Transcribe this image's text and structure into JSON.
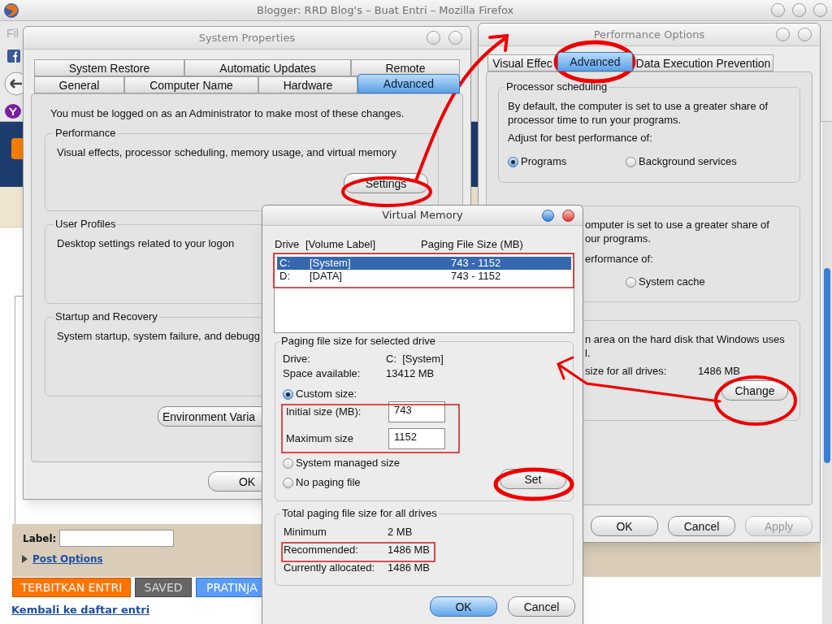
{
  "browser": {
    "title": "Blogger: RRD Blog's – Buat Entri – Mozilla Firefox",
    "menu": [
      "Fil"
    ],
    "page": {
      "label_caption": "Label:",
      "post_options": "Post Options",
      "actions": [
        {
          "label": "TERBITKAN ENTRI",
          "kind": "publish"
        },
        {
          "label": "SAVED",
          "kind": "saved"
        },
        {
          "label": "PRATINJA",
          "kind": "preview"
        }
      ],
      "back_link": "Kembali ke daftar entri"
    }
  },
  "system_properties": {
    "title": "System Properties",
    "tab_rows": [
      [
        {
          "label": "System Restore",
          "selected": false
        },
        {
          "label": "Automatic Updates",
          "selected": false
        },
        {
          "label": "Remote",
          "selected": false
        }
      ],
      [
        {
          "label": "General",
          "selected": false
        },
        {
          "label": "Computer Name",
          "selected": false
        },
        {
          "label": "Hardware",
          "selected": false
        },
        {
          "label": "Advanced",
          "selected": true
        }
      ]
    ],
    "notice": "You must be logged on as an Administrator to make most of these changes.",
    "groups": [
      {
        "title": "Performance",
        "text": "Visual effects, processor scheduling, memory usage, and virtual memory",
        "button": "Settings"
      },
      {
        "title": "User Profiles",
        "text": "Desktop settings related to your logon"
      },
      {
        "title": "Startup and Recovery",
        "text": "System startup, system failure, and debugg"
      }
    ],
    "extra_button": "Environment Varia",
    "buttons": [
      "OK"
    ]
  },
  "performance_options": {
    "title": "Performance Options",
    "tabs": [
      {
        "label": "Visual Effec",
        "selected": false
      },
      {
        "label": "Advanced",
        "selected": true
      },
      {
        "label": "Data Execution Prevention",
        "selected": false
      }
    ],
    "processor_scheduling": {
      "title": "Processor scheduling",
      "text": "By default, the computer is set to use a greater share of processor time to run your programs.",
      "prompt": "Adjust for best performance of:",
      "options": [
        {
          "label": "Programs",
          "selected": true
        },
        {
          "label": "Background services",
          "selected": false
        }
      ]
    },
    "memory_usage": {
      "lines": [
        "omputer is set to use a greater share of",
        "our programs.",
        "erformance of:"
      ],
      "options": [
        {
          "label": "System cache",
          "selected": false
        }
      ]
    },
    "virtual_memory": {
      "lines": [
        "n area on the hard disk that Windows uses",
        "l."
      ],
      "total_label": "size for all drives:",
      "total_value": "1486 MB",
      "button": "Change"
    },
    "buttons": [
      {
        "label": "OK",
        "disabled": false
      },
      {
        "label": "Cancel",
        "disabled": false
      },
      {
        "label": "Apply",
        "disabled": true
      }
    ]
  },
  "virtual_memory": {
    "title": "Virtual Memory",
    "columns": [
      "Drive",
      "[Volume Label]",
      "Paging File Size (MB)"
    ],
    "rows": [
      {
        "drive": "C:",
        "label": "[System]",
        "size": "743 - 1152",
        "selected": true
      },
      {
        "drive": "D:",
        "label": "[DATA]",
        "size": "743 - 1152",
        "selected": false
      }
    ],
    "selected_drive": {
      "title": "Paging file size for selected drive",
      "fields": [
        {
          "label": "Drive:",
          "value": "C:  [System]"
        },
        {
          "label": "Space available:",
          "value": "13412 MB"
        }
      ],
      "options": [
        {
          "label": "Custom size:",
          "selected": true
        },
        {
          "label": "System managed size",
          "selected": false
        },
        {
          "label": "No paging file",
          "selected": false
        }
      ],
      "inputs": [
        {
          "label": "Initial size (MB):",
          "value": "743"
        },
        {
          "label": "Maximum size",
          "value": "1152"
        }
      ],
      "button": "Set"
    },
    "totals": {
      "title": "Total paging file size for all drives",
      "fields": [
        {
          "label": "Minimum",
          "value": "2 MB"
        },
        {
          "label": "Recommended:",
          "value": "1486 MB"
        },
        {
          "label": "Currently allocated:",
          "value": "1486 MB"
        }
      ]
    },
    "buttons": [
      {
        "label": "OK",
        "default": true
      },
      {
        "label": "Cancel",
        "default": false
      }
    ]
  }
}
